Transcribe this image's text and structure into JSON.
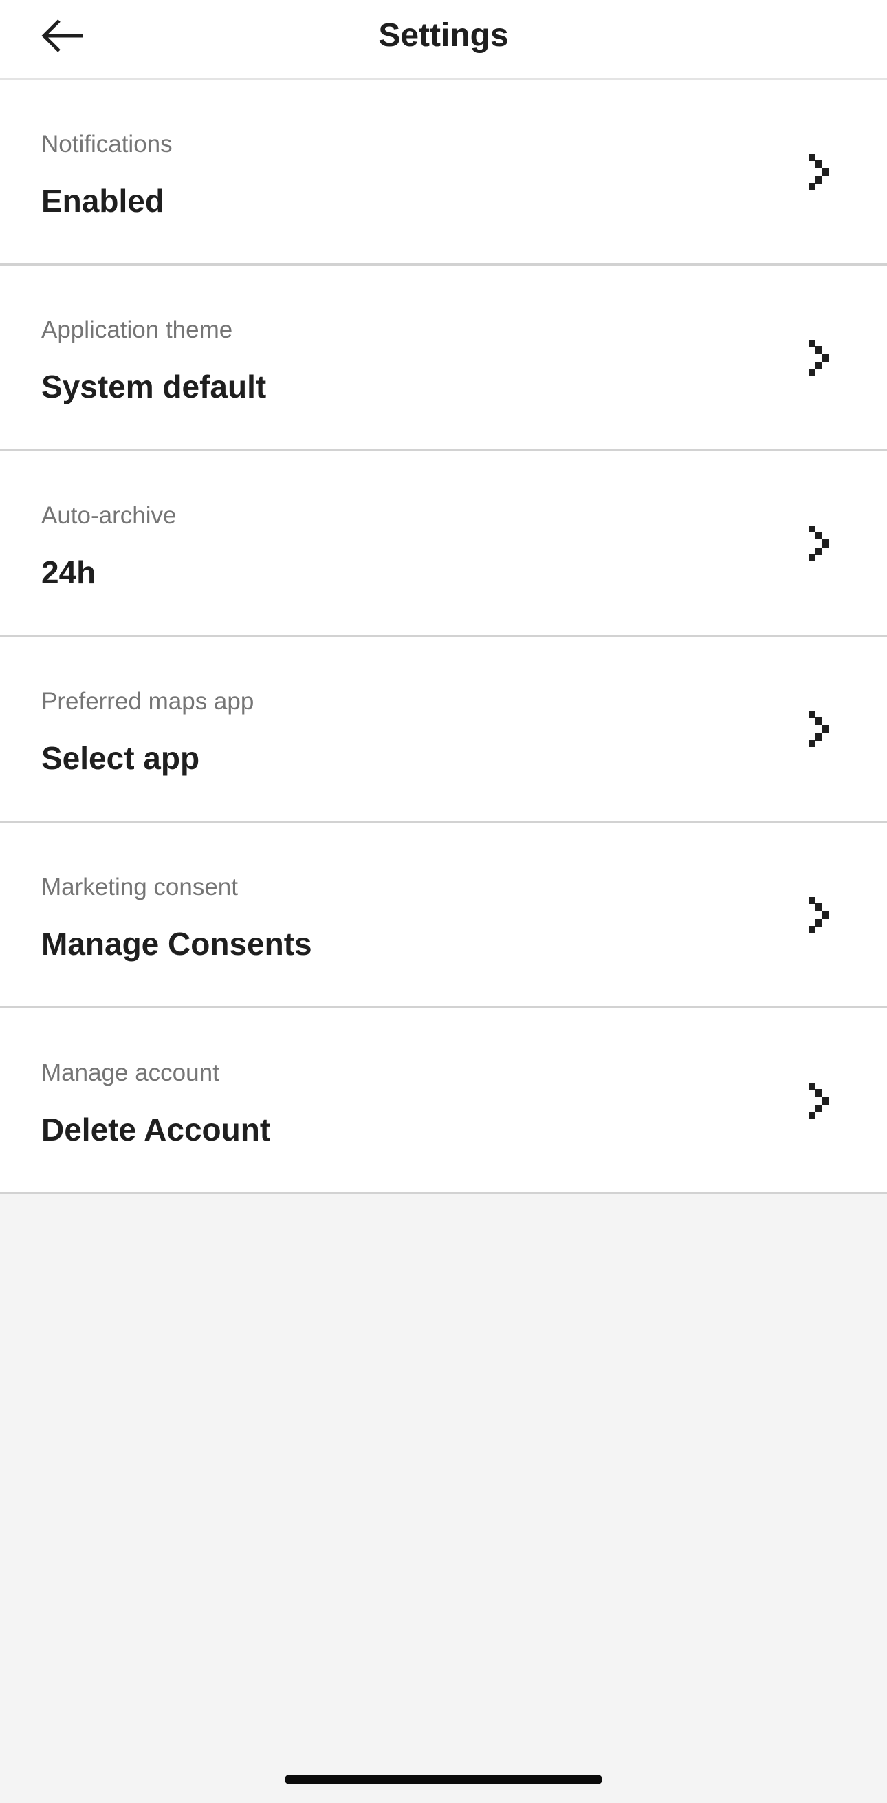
{
  "header": {
    "title": "Settings",
    "back_icon": "arrow-left-icon"
  },
  "settings": {
    "items": [
      {
        "label": "Notifications",
        "value": "Enabled",
        "icon": "chevron-right-icon"
      },
      {
        "label": "Application theme",
        "value": "System default",
        "icon": "chevron-right-icon"
      },
      {
        "label": "Auto-archive",
        "value": "24h",
        "icon": "chevron-right-icon"
      },
      {
        "label": "Preferred maps app",
        "value": "Select app",
        "icon": "chevron-right-icon"
      },
      {
        "label": "Marketing consent",
        "value": "Manage Consents",
        "icon": "chevron-right-icon"
      },
      {
        "label": "Manage account",
        "value": "Delete Account",
        "icon": "chevron-right-icon"
      }
    ]
  },
  "colors": {
    "background": "#f4f4f4",
    "surface": "#ffffff",
    "text_primary": "#1f1f1f",
    "text_secondary": "#757575",
    "divider": "#d2d2d2"
  }
}
